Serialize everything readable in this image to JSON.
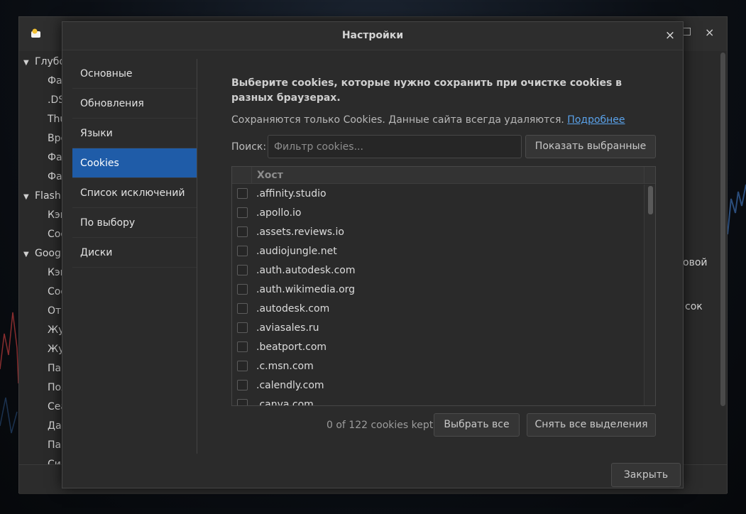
{
  "main_window": {
    "tree": [
      {
        "type": "group",
        "label": "Глубо"
      },
      {
        "type": "child",
        "label": "Фай"
      },
      {
        "type": "child",
        "label": ".DS"
      },
      {
        "type": "child",
        "label": "Thu"
      },
      {
        "type": "child",
        "label": "Вре"
      },
      {
        "type": "child",
        "label": "Фай"
      },
      {
        "type": "child",
        "label": "Фай"
      },
      {
        "type": "group",
        "label": "Flash I"
      },
      {
        "type": "child",
        "label": "Кэш"
      },
      {
        "type": "child",
        "label": "Coo"
      },
      {
        "type": "group",
        "label": "Googl"
      },
      {
        "type": "child",
        "label": "Кэш"
      },
      {
        "type": "child",
        "label": "Coo"
      },
      {
        "type": "child",
        "label": "Отч"
      },
      {
        "type": "child",
        "label": "Жур"
      },
      {
        "type": "child",
        "label": "Жур"
      },
      {
        "type": "child",
        "label": "Пар"
      },
      {
        "type": "child",
        "label": "Пол"
      },
      {
        "type": "child",
        "label": "Сеа"
      },
      {
        "type": "child",
        "label": "Дан"
      },
      {
        "type": "child",
        "label": "Пар"
      },
      {
        "type": "child",
        "label": "Син"
      }
    ],
    "right_fragments": {
      "line1": "овой",
      "line2": "сок"
    },
    "close_glyph": "×",
    "minimize_glyph": "□"
  },
  "dialog": {
    "title": "Настройки",
    "close_glyph": "×",
    "nav": [
      {
        "label": "Основные",
        "active": false
      },
      {
        "label": "Обновления",
        "active": false
      },
      {
        "label": "Языки",
        "active": false
      },
      {
        "label": "Cookies",
        "active": true
      },
      {
        "label": "Список исключений",
        "active": false
      },
      {
        "label": "По выбору",
        "active": false
      },
      {
        "label": "Диски",
        "active": false
      }
    ],
    "headline": "Выберите cookies, которые нужно сохранить при очистке cookies в разных браузерах.",
    "subline": "Сохраняются только Cookies. Данные сайта всегда удаляются.",
    "more_link": "Подробнее",
    "search_label": "Поиск:",
    "search_placeholder": "Фильтр cookies...",
    "search_value": "",
    "show_selected_label": "Показать выбранные",
    "table": {
      "header_host": "Хост",
      "hosts": [
        ".affinity.studio",
        ".apollo.io",
        ".assets.reviews.io",
        ".audiojungle.net",
        ".auth.autodesk.com",
        ".auth.wikimedia.org",
        ".autodesk.com",
        ".aviasales.ru",
        ".beatport.com",
        ".c.msn.com",
        ".calendly.com",
        ".canva.com"
      ]
    },
    "kept_status": "0 of 122 cookies kept",
    "select_all_label": "Выбрать все",
    "deselect_all_label": "Снять все выделения",
    "close_button_label": "Закрыть"
  },
  "colors": {
    "accent": "#1f5ca8",
    "link": "#5aa2ea"
  }
}
